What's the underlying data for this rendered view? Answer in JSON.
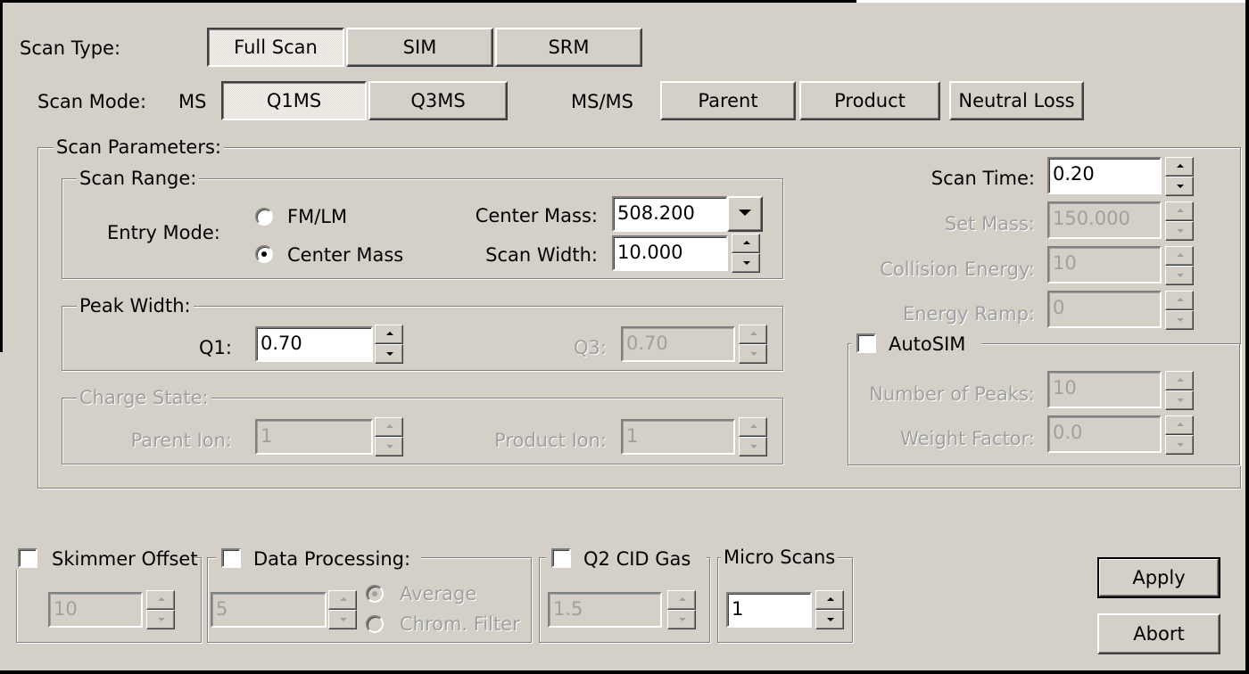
{
  "scan_type": {
    "label": "Scan Type:",
    "buttons": [
      "Full Scan",
      "SIM",
      "SRM"
    ],
    "selected": "Full Scan"
  },
  "scan_mode": {
    "label": "Scan Mode:",
    "ms_label": "MS",
    "msms_label": "MS/MS",
    "ms_buttons": [
      "Q1MS",
      "Q3MS"
    ],
    "msms_buttons": [
      "Parent",
      "Product",
      "Neutral Loss"
    ],
    "selected": "Q1MS"
  },
  "scan_parameters": {
    "title": "Scan Parameters:",
    "scan_range": {
      "title": "Scan Range:",
      "entry_mode_label": "Entry Mode:",
      "options": [
        "FM/LM",
        "Center Mass"
      ],
      "selected": "Center Mass",
      "center_mass_label": "Center Mass:",
      "center_mass_value": "508.200",
      "scan_width_label": "Scan Width:",
      "scan_width_value": "10.000"
    },
    "peak_width": {
      "title": "Peak Width:",
      "q1_label": "Q1:",
      "q1_value": "0.70",
      "q3_label": "Q3:",
      "q3_value": "0.70"
    },
    "charge_state": {
      "title": "Charge State:",
      "parent_ion_label": "Parent Ion:",
      "parent_ion_value": "1",
      "product_ion_label": "Product Ion:",
      "product_ion_value": "1"
    },
    "scan_time_label": "Scan Time:",
    "scan_time_value": "0.20",
    "set_mass_label": "Set Mass:",
    "set_mass_value": "150.000",
    "collision_energy_label": "Collision Energy:",
    "collision_energy_value": "10",
    "energy_ramp_label": "Energy Ramp:",
    "energy_ramp_value": "0",
    "autosim": {
      "title": "AutoSIM",
      "number_of_peaks_label": "Number of Peaks:",
      "number_of_peaks_value": "10",
      "weight_factor_label": "Weight Factor:",
      "weight_factor_value": "0.0"
    }
  },
  "bottom": {
    "skimmer_offset": {
      "label": "Skimmer Offset",
      "value": "10"
    },
    "data_processing": {
      "label": "Data Processing:",
      "value": "5",
      "options": [
        "Average",
        "Chrom. Filter"
      ],
      "selected": "Average"
    },
    "q2_cid_gas": {
      "label": "Q2 CID Gas",
      "value": "1.5"
    },
    "micro_scans": {
      "label": "Micro Scans",
      "value": "1"
    }
  },
  "actions": {
    "apply_label": "Apply",
    "abort_label": "Abort"
  },
  "colors": {
    "face": "#d4d0c8",
    "disabled_text": "#a0a0a0"
  }
}
